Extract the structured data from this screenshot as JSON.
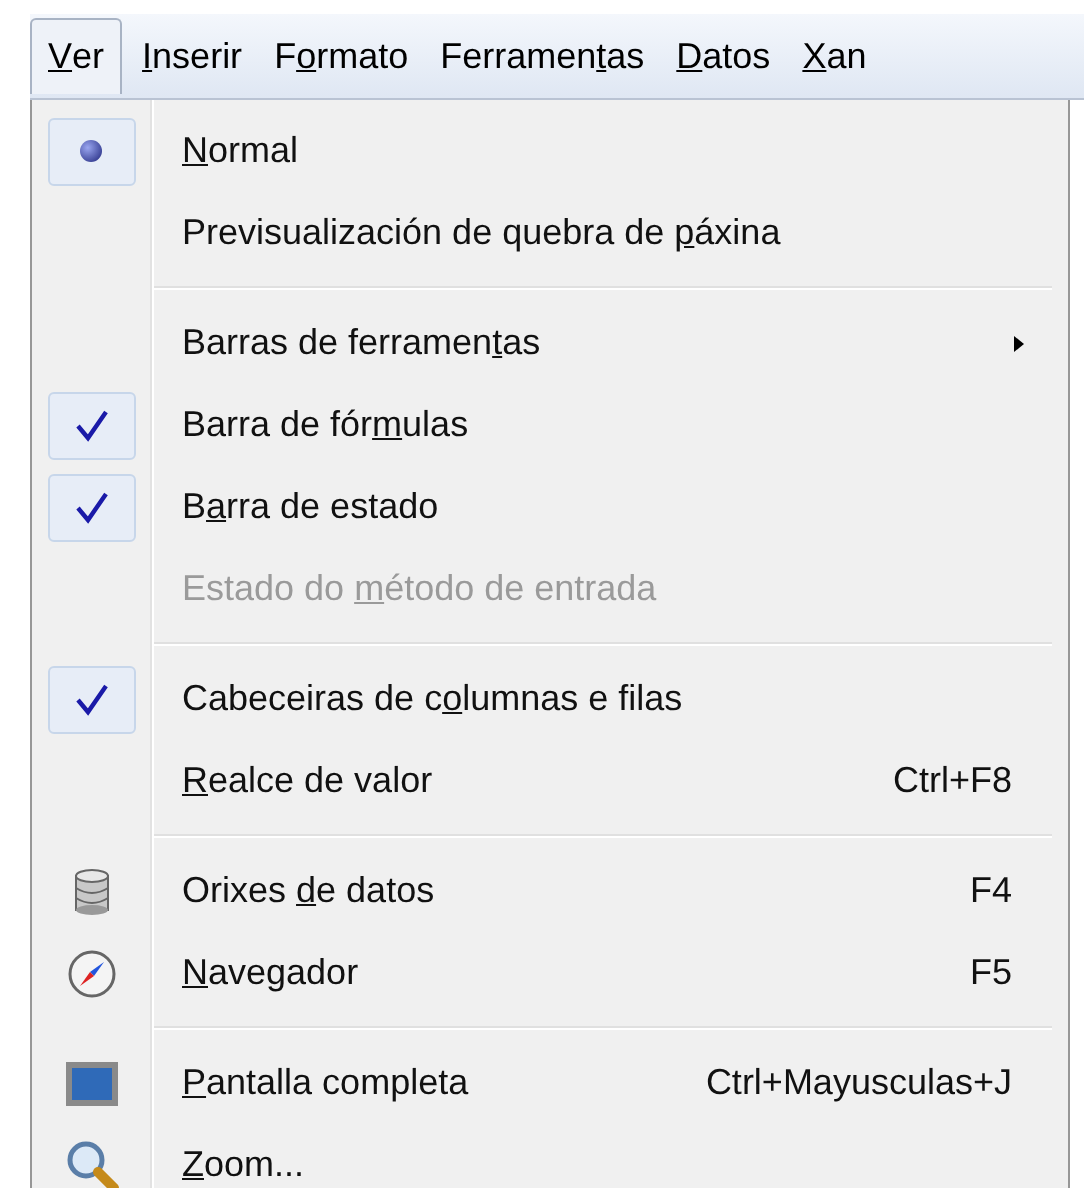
{
  "menu_bar": [
    {
      "label": {
        "key": "V",
        "after": "er"
      },
      "selected": true
    },
    {
      "label": {
        "key": "I",
        "after": "nserir"
      },
      "selected": false
    },
    {
      "label": {
        "before": "F",
        "key": "o",
        "after": "rmato"
      },
      "selected": false
    },
    {
      "label": {
        "before": "Ferramen",
        "key": "t",
        "after": "as"
      },
      "selected": false
    },
    {
      "label": {
        "key": "D",
        "after": "atos"
      },
      "selected": false
    },
    {
      "label": {
        "key": "X",
        "after": "an"
      },
      "selected": false
    }
  ],
  "menu": [
    {
      "kind": "radio",
      "label": {
        "key": "N",
        "after": "ormal"
      },
      "selected": true,
      "disabled": false
    },
    {
      "kind": "radio",
      "label": {
        "before": "Previsualización de quebra de ",
        "key": "p",
        "after": "áxina"
      },
      "selected": false,
      "disabled": false
    },
    {
      "kind": "separator"
    },
    {
      "kind": "submenu",
      "label": {
        "before": "Barras de ferramen",
        "key": "t",
        "after": "as"
      },
      "disabled": false
    },
    {
      "kind": "check",
      "label": {
        "before": "Barra de fór",
        "key": "m",
        "after": "ulas"
      },
      "checked": true,
      "disabled": false
    },
    {
      "kind": "check",
      "label": {
        "before": "B",
        "key": "a",
        "after": "rra de estado"
      },
      "checked": true,
      "disabled": false
    },
    {
      "kind": "check",
      "label": {
        "before": "Estado do ",
        "key": "m",
        "after": "étodo de entrada"
      },
      "checked": false,
      "disabled": true
    },
    {
      "kind": "separator"
    },
    {
      "kind": "check",
      "label": {
        "before": "Cabeceiras de c",
        "key": "o",
        "after": "lumnas e filas"
      },
      "checked": true,
      "disabled": false
    },
    {
      "kind": "check",
      "label": {
        "key": "R",
        "after": "ealce de valor"
      },
      "checked": false,
      "disabled": false,
      "shortcut": "Ctrl+F8"
    },
    {
      "kind": "separator"
    },
    {
      "kind": "icon",
      "label": {
        "before": "Orixes ",
        "key": "d",
        "after": "e datos"
      },
      "disabled": false,
      "shortcut": "F4"
    },
    {
      "kind": "icon",
      "label": {
        "key": "N",
        "after": "avegador"
      },
      "disabled": false,
      "shortcut": "F5"
    },
    {
      "kind": "separator"
    },
    {
      "kind": "icon",
      "label": {
        "key": "P",
        "after": "antalla completa"
      },
      "disabled": false,
      "shortcut": "Ctrl+Mayusculas+J"
    },
    {
      "kind": "icon",
      "label": {
        "key": "Z",
        "after": "oom..."
      },
      "disabled": false
    }
  ]
}
